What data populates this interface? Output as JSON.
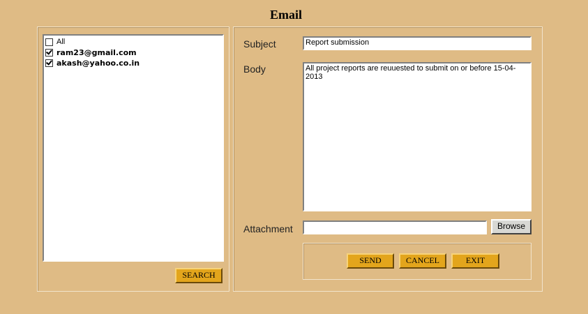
{
  "window": {
    "title": "Email"
  },
  "recipients": {
    "items": [
      {
        "label": "All",
        "checked": false
      },
      {
        "label": "ram23@gmail.com",
        "checked": true
      },
      {
        "label": "akash@yahoo.co.in",
        "checked": true
      }
    ],
    "search_label": "SEARCH"
  },
  "form": {
    "subject_label": "Subject",
    "subject_value": "Report submission",
    "body_label": "Body",
    "body_value": "All project reports are reuuested to submit on or before 15-04-2013",
    "attachment_label": "Attachment",
    "attachment_value": "",
    "browse_label": "Browse"
  },
  "actions": {
    "send_label": "SEND",
    "cancel_label": "CANCEL",
    "exit_label": "EXIT"
  },
  "colors": {
    "background": "#dfbb85",
    "button": "#e3a51c"
  }
}
